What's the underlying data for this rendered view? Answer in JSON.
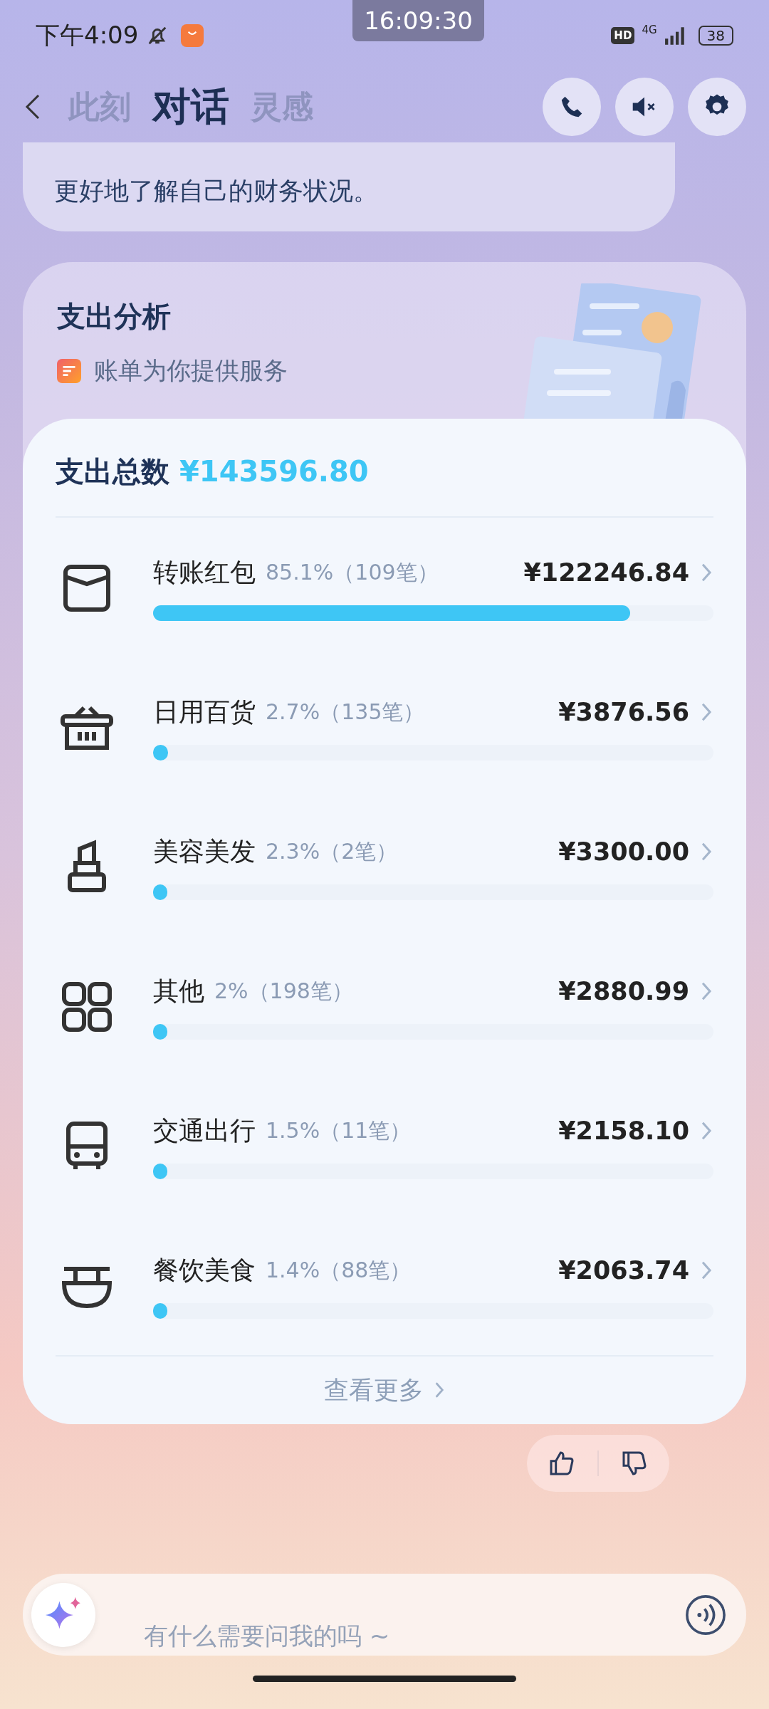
{
  "status_bar": {
    "time": "下午4:09",
    "clock": "16:09:30",
    "hd": "HD",
    "network": "4G",
    "battery": "38"
  },
  "nav": {
    "tabs": [
      {
        "label": "此刻",
        "selected": false
      },
      {
        "label": "对话",
        "selected": true
      },
      {
        "label": "灵感",
        "selected": false
      }
    ]
  },
  "message": {
    "text": "更好地了解自己的财务状况。"
  },
  "card": {
    "title": "支出分析",
    "source": "账单为你提供服务",
    "total_label": "支出总数",
    "total": "¥143596.80",
    "categories": [
      {
        "kind": "transfer",
        "name": "转账红包",
        "share": "85.1%（109笔）",
        "amount": "¥122246.84",
        "level": 0.851
      },
      {
        "kind": "groceries",
        "name": "日用百货",
        "share": "2.7%（135笔）",
        "amount": "¥3876.56",
        "level": 0.027
      },
      {
        "kind": "beauty",
        "name": "美容美发",
        "share": "2.3%（2笔）",
        "amount": "¥3300.00",
        "level": 0.023
      },
      {
        "kind": "other",
        "name": "其他",
        "share": "2%（198笔）",
        "amount": "¥2880.99",
        "level": 0.02
      },
      {
        "kind": "transit",
        "name": "交通出行",
        "share": "1.5%（11笔）",
        "amount": "¥2158.10",
        "level": 0.015
      },
      {
        "kind": "dining",
        "name": "餐饮美食",
        "share": "1.4%（88笔）",
        "amount": "¥2063.74",
        "level": 0.014
      }
    ],
    "more": "查看更多"
  },
  "input": {
    "placeholder": "有什么需要问我的吗 ~"
  }
}
